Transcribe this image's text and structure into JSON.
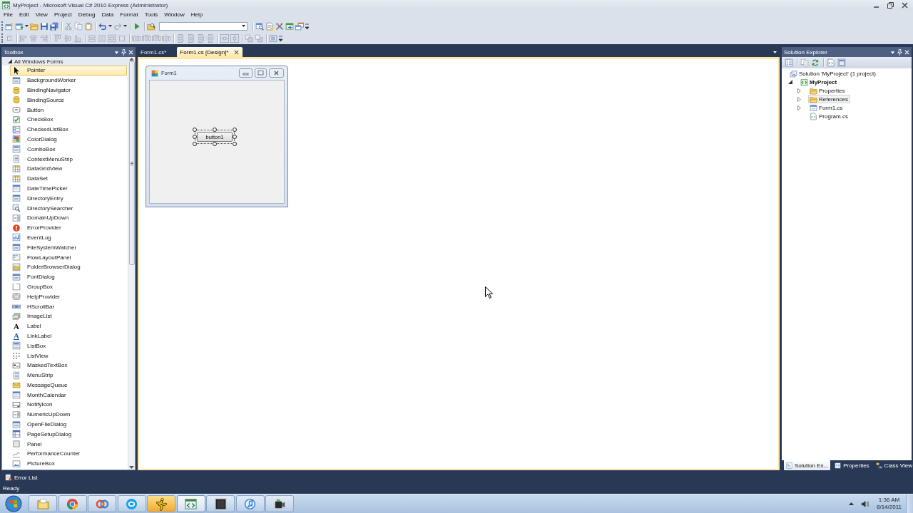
{
  "window": {
    "title": "MyProject - Microsoft Visual C# 2010 Express (Administrator)"
  },
  "menu": [
    "File",
    "Edit",
    "View",
    "Project",
    "Debug",
    "Data",
    "Format",
    "Tools",
    "Window",
    "Help"
  ],
  "toolbox": {
    "title": "Toolbox",
    "groups": [
      {
        "label": "All Windows Forms",
        "expanded": true,
        "items": [
          {
            "label": "Pointer",
            "selected": true
          },
          {
            "label": "BackgroundWorker",
            "selected": false
          },
          {
            "label": "BindingNavigator",
            "selected": false
          },
          {
            "label": "BindingSource",
            "selected": false
          },
          {
            "label": "Button",
            "selected": false
          },
          {
            "label": "CheckBox",
            "selected": false
          },
          {
            "label": "CheckedListBox",
            "selected": false
          },
          {
            "label": "ColorDialog",
            "selected": false
          },
          {
            "label": "ComboBox",
            "selected": false
          },
          {
            "label": "ContextMenuStrip",
            "selected": false
          },
          {
            "label": "DataGridView",
            "selected": false
          },
          {
            "label": "DataSet",
            "selected": false
          },
          {
            "label": "DateTimePicker",
            "selected": false
          },
          {
            "label": "DirectoryEntry",
            "selected": false
          },
          {
            "label": "DirectorySearcher",
            "selected": false
          },
          {
            "label": "DomainUpDown",
            "selected": false
          },
          {
            "label": "ErrorProvider",
            "selected": false
          },
          {
            "label": "EventLog",
            "selected": false
          },
          {
            "label": "FileSystemWatcher",
            "selected": false
          },
          {
            "label": "FlowLayoutPanel",
            "selected": false
          },
          {
            "label": "FolderBrowserDialog",
            "selected": false
          },
          {
            "label": "FontDialog",
            "selected": false
          },
          {
            "label": "GroupBox",
            "selected": false
          },
          {
            "label": "HelpProvider",
            "selected": false
          },
          {
            "label": "HScrollBar",
            "selected": false
          },
          {
            "label": "ImageList",
            "selected": false
          },
          {
            "label": "Label",
            "glyph": "A",
            "selected": false
          },
          {
            "label": "LinkLabel",
            "glyph": "A",
            "selected": false
          },
          {
            "label": "ListBox",
            "selected": false
          },
          {
            "label": "ListView",
            "selected": false
          },
          {
            "label": "MaskedTextBox",
            "selected": false
          },
          {
            "label": "MenuStrip",
            "selected": false
          },
          {
            "label": "MessageQueue",
            "selected": false
          },
          {
            "label": "MonthCalendar",
            "selected": false
          },
          {
            "label": "NotifyIcon",
            "selected": false
          },
          {
            "label": "NumericUpDown",
            "selected": false
          },
          {
            "label": "OpenFileDialog",
            "selected": false
          },
          {
            "label": "PageSetupDialog",
            "selected": false
          },
          {
            "label": "Panel",
            "selected": false
          },
          {
            "label": "PerformanceCounter",
            "selected": false
          },
          {
            "label": "PictureBox",
            "selected": false
          }
        ]
      }
    ]
  },
  "document_tabs": [
    {
      "label": "Form1.cs*",
      "selected": false
    },
    {
      "label": "Form1.cs [Design]*",
      "selected": true
    }
  ],
  "designer": {
    "form": {
      "title": "Form1"
    },
    "controls": [
      {
        "kind": "button",
        "label": "button1",
        "selected": true
      }
    ]
  },
  "solution_explorer": {
    "title": "Solution Explorer",
    "tree": [
      {
        "kind": "solution",
        "label": "Solution 'MyProject' (1 project)",
        "selected": false,
        "children": [
          {
            "kind": "project",
            "label": "MyProject",
            "expanded": true,
            "selected": false,
            "children": [
              {
                "kind": "folder",
                "label": "Properties",
                "expanded": false,
                "selected": false
              },
              {
                "kind": "references",
                "label": "References",
                "expanded": false,
                "selected": true
              },
              {
                "kind": "form",
                "label": "Form1.cs",
                "expanded": false,
                "selected": false
              },
              {
                "kind": "code",
                "label": "Program.cs",
                "selected": false
              }
            ]
          }
        ]
      }
    ]
  },
  "tool_tabs": [
    {
      "label": "Solution Ex...",
      "selected": true
    },
    {
      "label": "Properties",
      "selected": false
    },
    {
      "label": "Class View",
      "selected": false
    }
  ],
  "bottom_tabs": [
    {
      "label": "Error List"
    }
  ],
  "status_bar": {
    "text": "Ready"
  },
  "taskbar": {
    "buttons": [
      {
        "selected": false,
        "flashing": false
      },
      {
        "selected": false,
        "flashing": false
      },
      {
        "selected": false,
        "flashing": false
      },
      {
        "selected": false,
        "flashing": false
      },
      {
        "selected": false,
        "flashing": true
      },
      {
        "selected": true,
        "flashing": false
      },
      {
        "selected": false,
        "flashing": false
      },
      {
        "selected": false,
        "flashing": false
      },
      {
        "selected": false,
        "flashing": false
      }
    ],
    "clock": {
      "time": "1:36 AM",
      "date": "8/14/2011"
    }
  }
}
